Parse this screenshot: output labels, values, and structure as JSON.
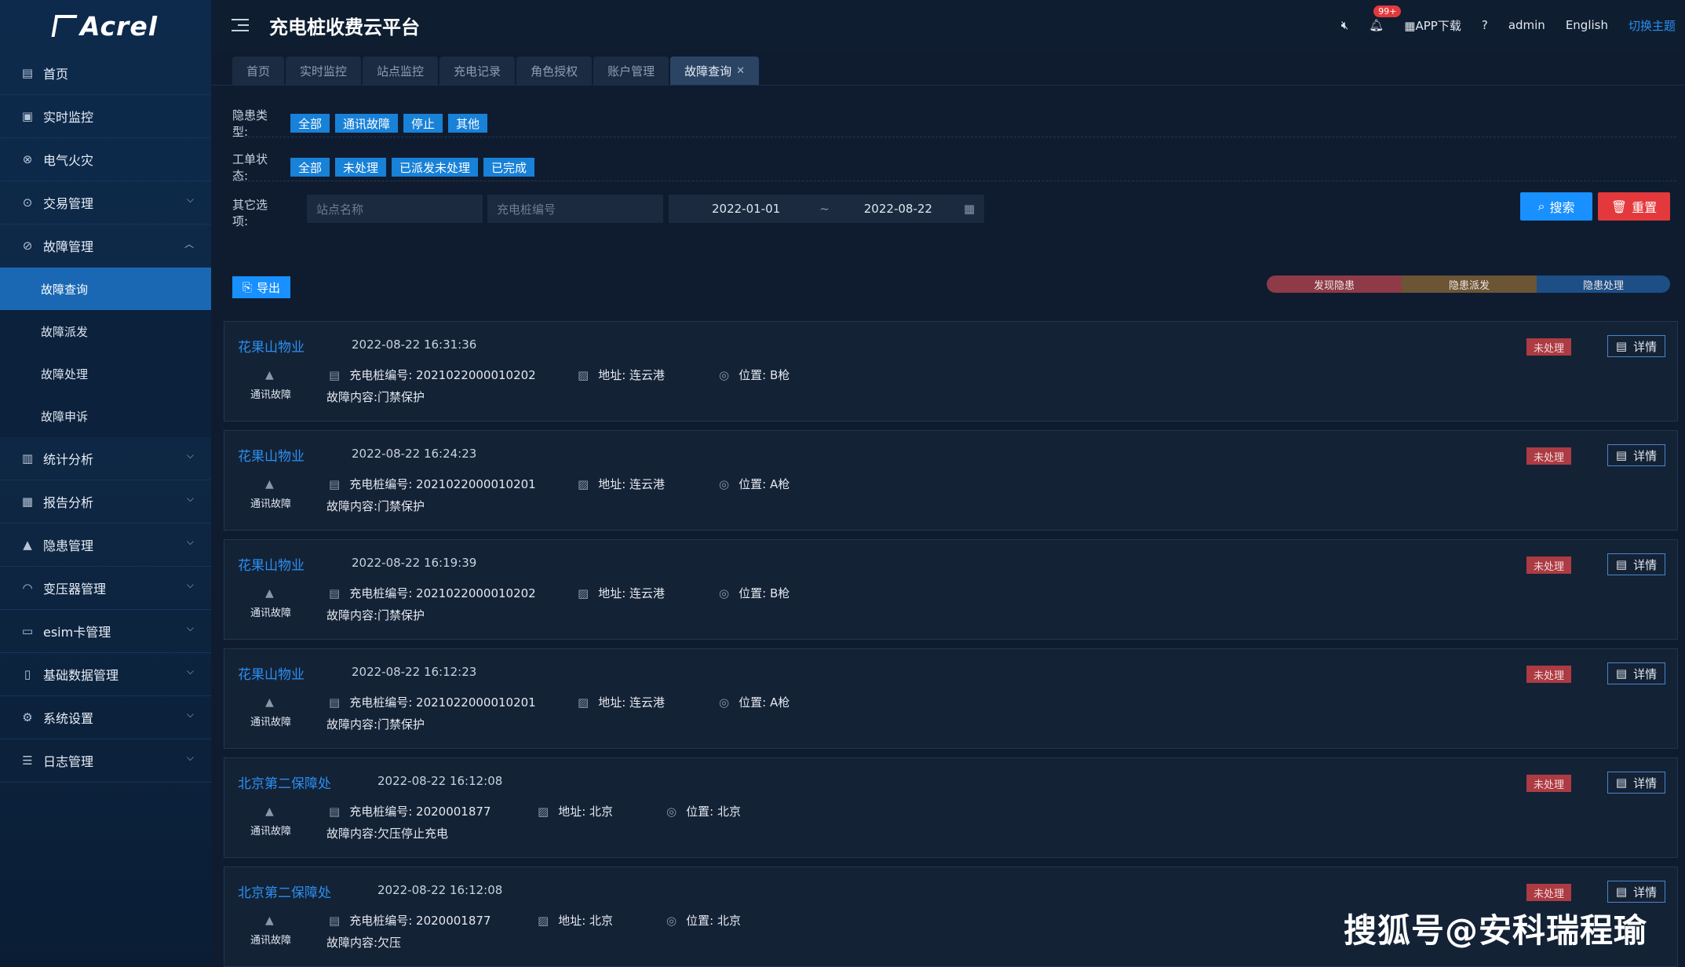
{
  "brand": {
    "logo_text": "Acrel"
  },
  "sidebar": {
    "items": [
      {
        "label": "首页",
        "icon": "home-icon"
      },
      {
        "label": "实时监控",
        "icon": "monitor-icon"
      },
      {
        "label": "电气火灾",
        "icon": "fire-icon"
      },
      {
        "label": "交易管理",
        "icon": "transaction-icon",
        "expandable": true
      },
      {
        "label": "故障管理",
        "icon": "fault-icon",
        "expanded": true,
        "children": [
          {
            "label": "故障查询",
            "active": true
          },
          {
            "label": "故障派发"
          },
          {
            "label": "故障处理"
          },
          {
            "label": "故障申诉"
          }
        ]
      },
      {
        "label": "统计分析",
        "icon": "stats-icon",
        "expandable": true
      },
      {
        "label": "报告分析",
        "icon": "report-icon",
        "expandable": true
      },
      {
        "label": "隐患管理",
        "icon": "hazard-icon",
        "expandable": true
      },
      {
        "label": "变压器管理",
        "icon": "transformer-icon",
        "expandable": true
      },
      {
        "label": "esim卡管理",
        "icon": "sim-icon",
        "expandable": true
      },
      {
        "label": "基础数据管理",
        "icon": "database-icon",
        "expandable": true
      },
      {
        "label": "系统设置",
        "icon": "settings-icon",
        "expandable": true
      },
      {
        "label": "日志管理",
        "icon": "log-icon",
        "expandable": true
      }
    ]
  },
  "header": {
    "title": "充电桩收费云平台",
    "notification_count": "99+",
    "app_download": "APP下载",
    "user": "admin",
    "language": "English",
    "theme_switch": "切换主题"
  },
  "tabs": [
    {
      "label": "首页"
    },
    {
      "label": "实时监控"
    },
    {
      "label": "站点监控"
    },
    {
      "label": "充电记录"
    },
    {
      "label": "角色授权"
    },
    {
      "label": "账户管理"
    },
    {
      "label": "故障查询",
      "active": true,
      "closable": true
    }
  ],
  "filters": {
    "hazard_type_label": "隐患类型:",
    "hazard_types": [
      "全部",
      "通讯故障",
      "停止",
      "其他"
    ],
    "order_status_label": "工单状态:",
    "order_statuses": [
      "全部",
      "未处理",
      "已派发未处理",
      "已完成"
    ],
    "other_label": "其它选项:",
    "station_placeholder": "站点名称",
    "pile_placeholder": "充电桩编号",
    "date_start": "2022-01-01",
    "date_sep": "~",
    "date_end": "2022-08-22",
    "search_label": "搜索",
    "reset_label": "重置"
  },
  "toolbar": {
    "export_label": "导出",
    "legend": [
      {
        "label": "发现隐患",
        "color": "#8f3a47"
      },
      {
        "label": "隐患派发",
        "color": "#6b5534"
      },
      {
        "label": "隐患处理",
        "color": "#1d4f86"
      }
    ]
  },
  "records": [
    {
      "station": "花果山物业",
      "time": "2022-08-22 16:31:36",
      "type": "通讯故障",
      "pile_label": "充电桩编号:",
      "pile": "2021022000010202",
      "addr_label": "地址:",
      "address": "连云港",
      "pos_label": "位置:",
      "position": "B枪",
      "content": "故障内容:门禁保护",
      "status": "未处理",
      "detail": "详情"
    },
    {
      "station": "花果山物业",
      "time": "2022-08-22 16:24:23",
      "type": "通讯故障",
      "pile_label": "充电桩编号:",
      "pile": "2021022000010201",
      "addr_label": "地址:",
      "address": "连云港",
      "pos_label": "位置:",
      "position": "A枪",
      "content": "故障内容:门禁保护",
      "status": "未处理",
      "detail": "详情"
    },
    {
      "station": "花果山物业",
      "time": "2022-08-22 16:19:39",
      "type": "通讯故障",
      "pile_label": "充电桩编号:",
      "pile": "2021022000010202",
      "addr_label": "地址:",
      "address": "连云港",
      "pos_label": "位置:",
      "position": "B枪",
      "content": "故障内容:门禁保护",
      "status": "未处理",
      "detail": "详情"
    },
    {
      "station": "花果山物业",
      "time": "2022-08-22 16:12:23",
      "type": "通讯故障",
      "pile_label": "充电桩编号:",
      "pile": "2021022000010201",
      "addr_label": "地址:",
      "address": "连云港",
      "pos_label": "位置:",
      "position": "A枪",
      "content": "故障内容:门禁保护",
      "status": "未处理",
      "detail": "详情"
    },
    {
      "station": "北京第二保障处",
      "time": "2022-08-22 16:12:08",
      "type": "通讯故障",
      "pile_label": "充电桩编号:",
      "pile": "2020001877",
      "addr_label": "地址:",
      "address": "北京",
      "pos_label": "位置:",
      "position": "北京",
      "content": "故障内容:欠压停止充电",
      "status": "未处理",
      "detail": "详情"
    },
    {
      "station": "北京第二保障处",
      "time": "2022-08-22 16:12:08",
      "type": "通讯故障",
      "pile_label": "充电桩编号:",
      "pile": "2020001877",
      "addr_label": "地址:",
      "address": "北京",
      "pos_label": "位置:",
      "position": "北京",
      "content": "故障内容:欠压",
      "status": "未处理",
      "detail": "详情"
    }
  ],
  "watermark": "搜狐号@安科瑞程瑜"
}
